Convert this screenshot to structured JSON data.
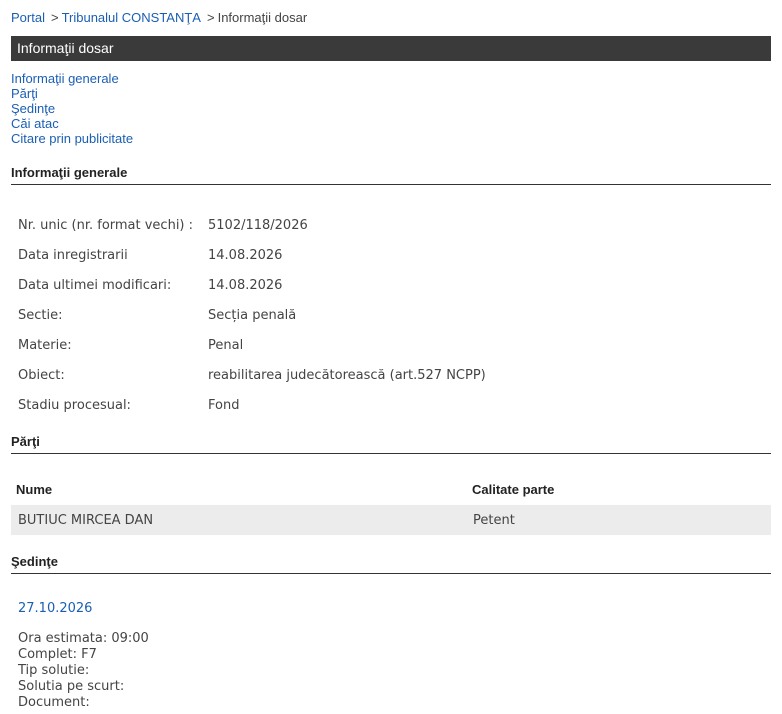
{
  "breadcrumb": {
    "portal": "Portal",
    "court": "Tribunalul CONSTANŢA",
    "current": "Informaţii dosar",
    "separator": ">"
  },
  "page_title": "Informaţii dosar",
  "toc": [
    "Informaţii generale",
    "Părţi",
    "Şedinţe",
    "Căi atac",
    "Citare prin publicitate"
  ],
  "general": {
    "title": "Informaţii generale",
    "rows": [
      {
        "label": "Nr. unic (nr. format vechi) :",
        "value": "5102/118/2026"
      },
      {
        "label": "Data inregistrarii",
        "value": "14.08.2026"
      },
      {
        "label": "Data ultimei modificari:",
        "value": "14.08.2026"
      },
      {
        "label": "Sectie:",
        "value": "Secția penală"
      },
      {
        "label": "Materie:",
        "value": "Penal"
      },
      {
        "label": "Obiect:",
        "value": "reabilitarea judecătorească (art.527 NCPP)"
      },
      {
        "label": "Stadiu procesual:",
        "value": "Fond"
      }
    ]
  },
  "parti": {
    "title": "Părţi",
    "headers": {
      "name": "Nume",
      "role": "Calitate parte"
    },
    "rows": [
      {
        "name": "BUTIUC MIRCEA DAN",
        "role": "Petent"
      }
    ]
  },
  "sedinte": {
    "title": "Şedinţe",
    "date": "27.10.2026",
    "details": [
      "Ora estimata: 09:00",
      "Complet: F7",
      "Tip solutie:",
      "Solutia pe scurt:",
      "Document:"
    ]
  }
}
